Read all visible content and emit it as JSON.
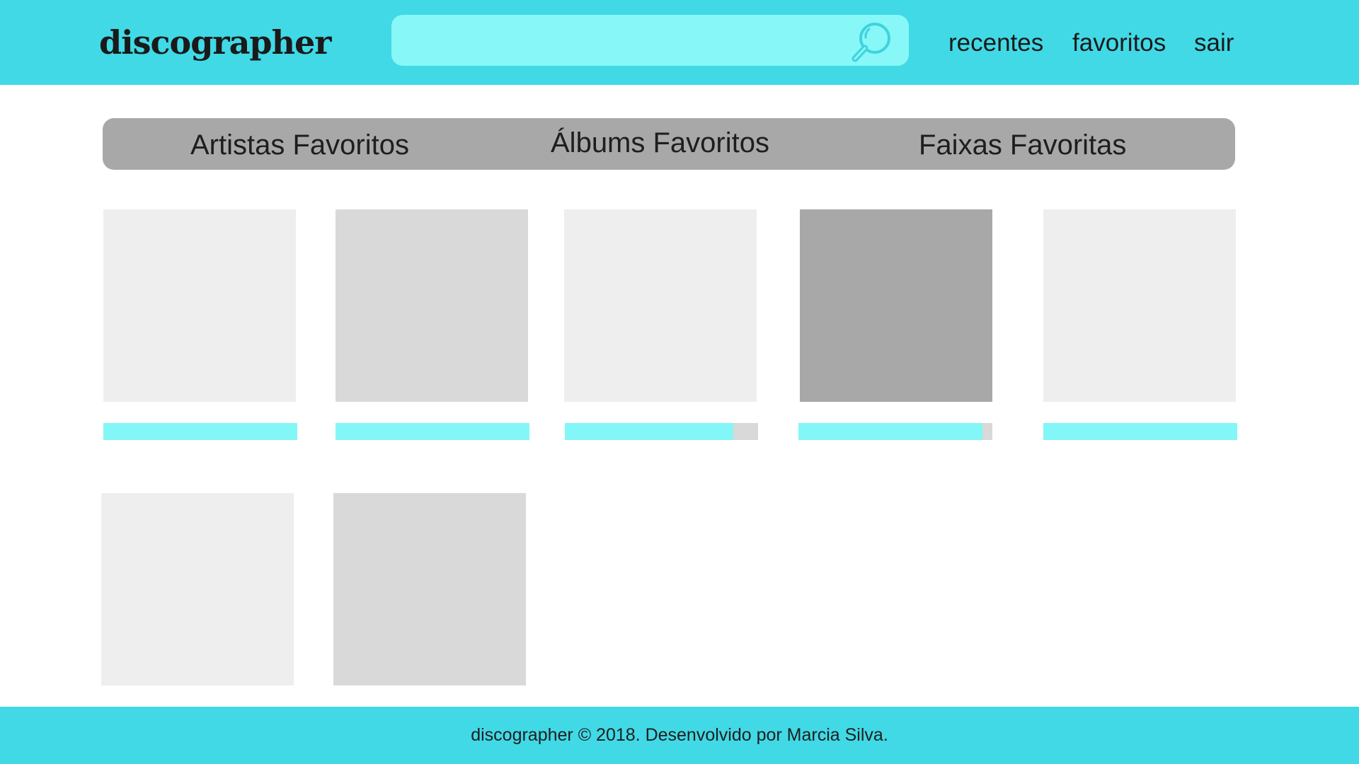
{
  "header": {
    "logo": "discographer",
    "search": {
      "value": "",
      "placeholder": ""
    },
    "nav": [
      "recentes",
      "favoritos",
      "sair"
    ]
  },
  "tabs": [
    "Artistas Favoritos",
    "Álbums Favoritos",
    "Faixas Favoritas"
  ],
  "grid": {
    "items": [
      {
        "shade": "#eeeeee",
        "progress": 1.0
      },
      {
        "shade": "#d9d9d9",
        "progress": 1.0
      },
      {
        "shade": "#eeeeee",
        "progress": 0.87
      },
      {
        "shade": "#a8a8a8",
        "progress": 0.95
      },
      {
        "shade": "#eeeeee",
        "progress": 1.0
      },
      {
        "shade": "#eeeeee"
      },
      {
        "shade": "#d9d9d9"
      }
    ]
  },
  "footer": {
    "text": "discographer © 2018. Desenvolvido por Marcia Silva."
  },
  "colors": {
    "brand": "#41d9e6",
    "search_bg": "#88f7f7",
    "accent_bar": "#83f7f7",
    "tabbar_bg": "#a8a8a8",
    "track_bg": "#d9d9d9"
  }
}
